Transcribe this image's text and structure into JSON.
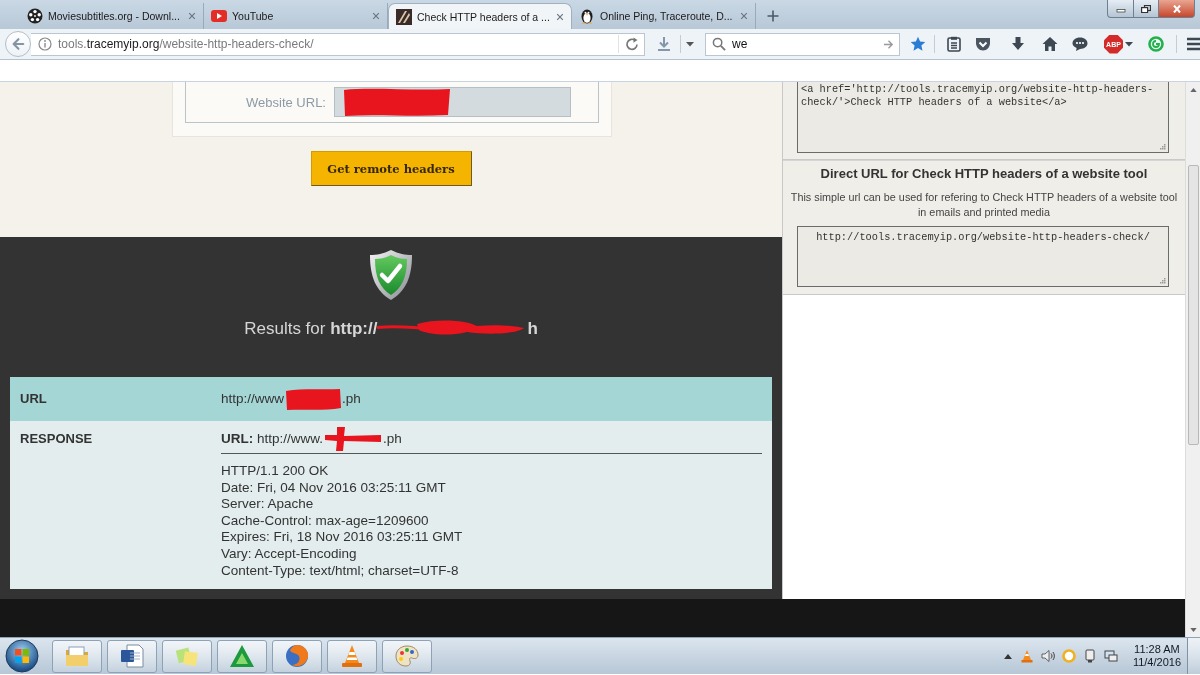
{
  "browser": {
    "tabs": [
      {
        "title": "Moviesubtitles.org - Downl...",
        "selected": false
      },
      {
        "title": "YouTube",
        "selected": false
      },
      {
        "title": "Check HTTP headers of a ...",
        "selected": true
      },
      {
        "title": "Online Ping, Traceroute, D...",
        "selected": false
      }
    ],
    "address_bar": {
      "subdomain": "tools.",
      "domain": "tracemyip.org",
      "path": "/website-http-headers-check/"
    },
    "search_field": {
      "value": "we"
    },
    "extension_badge": "ABP"
  },
  "form": {
    "label": "Website URL:",
    "submit_button": "Get remote headers"
  },
  "results": {
    "heading": "Results for **http://**",
    "heading_tail": "h",
    "rows": [
      {
        "kind": "url",
        "label": "URL",
        "value": "http://www",
        "value_tail": ".ph"
      },
      {
        "kind": "response",
        "label": "RESPONSE",
        "value": "**URL:** http://www.",
        "value_tail": ".ph",
        "headers": [
          "HTTP/1.1 200 OK",
          "Date: Fri, 04 Nov 2016 03:25:11 GMT",
          "Server: Apache",
          "Cache-Control: max-age=1209600",
          "Expires: Fri, 18 Nov 2016 03:25:11 GMT",
          "Vary: Accept-Encoding",
          "Content-Type: text/html; charset=UTF-8"
        ]
      }
    ]
  },
  "sidebar": {
    "link_code": "<a href='http://tools.tracemyip.org/website-http-headers-check/'>Check HTTP headers of a website</a>",
    "direct_url": {
      "title": "Direct URL for Check HTTP headers of a website tool",
      "description": "This simple url can be used for refering to Check HTTP headers of a website tool in emails and printed media",
      "url": "http://tools.tracemyip.org/website-http-headers-check/"
    }
  },
  "taskbar": {
    "time": "11:28 AM",
    "date": "11/4/2016"
  }
}
